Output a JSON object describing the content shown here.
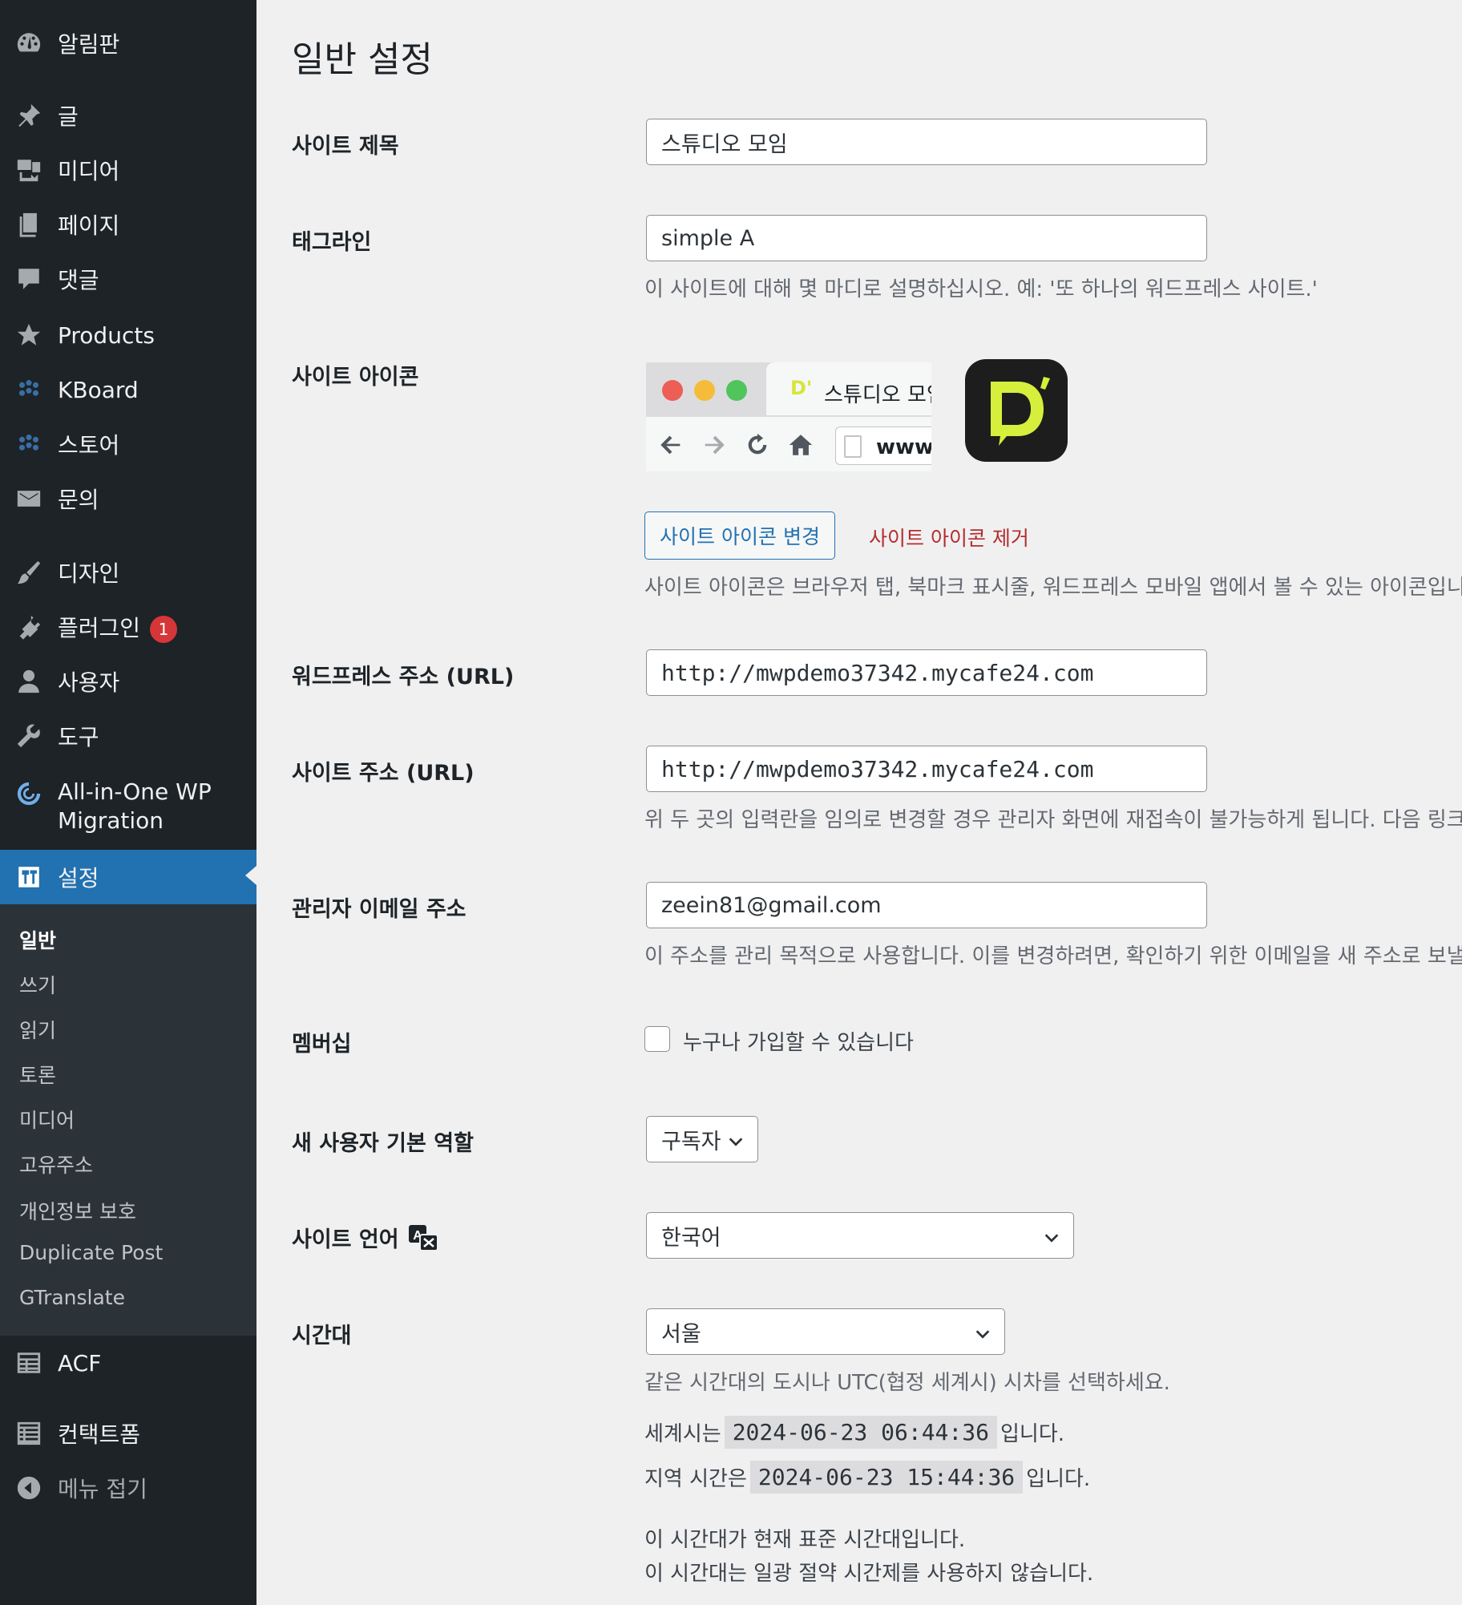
{
  "sidebar": {
    "items": [
      {
        "label": "알림판",
        "icon": "dashboard-icon"
      },
      {
        "label": "글",
        "icon": "pin-icon"
      },
      {
        "label": "미디어",
        "icon": "media-icon"
      },
      {
        "label": "페이지",
        "icon": "page-icon"
      },
      {
        "label": "댓글",
        "icon": "comment-icon"
      },
      {
        "label": "Products",
        "icon": "star-icon"
      },
      {
        "label": "KBoard",
        "icon": "kboard-icon"
      },
      {
        "label": "스토어",
        "icon": "store-icon"
      },
      {
        "label": "문의",
        "icon": "mail-icon"
      },
      {
        "label": "디자인",
        "icon": "brush-icon"
      },
      {
        "label": "플러그인",
        "icon": "plugin-icon",
        "badge": "1"
      },
      {
        "label": "사용자",
        "icon": "user-icon"
      },
      {
        "label": "도구",
        "icon": "wrench-icon"
      },
      {
        "label": "All-in-One WP",
        "label2": "Migration",
        "icon": "migration-icon"
      },
      {
        "label": "설정",
        "icon": "settings-icon",
        "current": true
      },
      {
        "label": "ACF",
        "icon": "acf-icon"
      },
      {
        "label": "컨택트폼",
        "icon": "form-icon"
      },
      {
        "label": "메뉴 접기",
        "icon": "collapse-icon"
      }
    ],
    "submenu": [
      "일반",
      "쓰기",
      "읽기",
      "토론",
      "미디어",
      "고유주소",
      "개인정보 보호",
      "Duplicate Post",
      "GTranslate"
    ]
  },
  "page": {
    "title": "일반 설정"
  },
  "fields": {
    "site_title": {
      "label": "사이트 제목",
      "value": "스튜디오 모임"
    },
    "tagline": {
      "label": "태그라인",
      "value": "simple A",
      "description": "이 사이트에 대해 몇 마디로 설명하십시오. 예: '또 하나의 워드프레스 사이트.'"
    },
    "site_icon": {
      "label": "사이트 아이콘",
      "preview_tab_text": "스튜디오 모임",
      "preview_url_text": "www.",
      "change_button": "사이트 아이콘 변경",
      "remove_button": "사이트 아이콘 제거",
      "description": "사이트 아이콘은 브라우저 탭, 북마크 표시줄, 워드프레스 모바일 앱에서 볼 수 있는 아이콘입니"
    },
    "wp_url": {
      "label": "워드프레스 주소 (URL)",
      "value": "http://mwpdemo37342.mycafe24.com"
    },
    "site_url": {
      "label": "사이트 주소 (URL)",
      "value": "http://mwpdemo37342.mycafe24.com",
      "description": "위 두 곳의 입력란을 임의로 변경할 경우 관리자 화면에 재접속이 불가능하게 됩니다. 다음 링크"
    },
    "admin_email": {
      "label": "관리자 이메일 주소",
      "value": "zeein81@gmail.com",
      "description": "이 주소를 관리 목적으로 사용합니다. 이를 변경하려면, 확인하기 위한 이메일을 새 주소로 보낼"
    },
    "membership": {
      "label": "멤버십",
      "checkbox_label": "누구나 가입할 수 있습니다",
      "checked": false
    },
    "default_role": {
      "label": "새 사용자 기본 역할",
      "value": "구독자"
    },
    "site_language": {
      "label": "사이트 언어",
      "value": "한국어"
    },
    "timezone": {
      "label": "시간대",
      "value": "서울",
      "description": "같은 시간대의 도시나 UTC(협정 세계시) 시차를 선택하세요.",
      "utc_prefix": "세계시는",
      "utc_time": "2024-06-23 06:44:36",
      "utc_suffix": "입니다.",
      "local_prefix": "지역 시간은",
      "local_time": "2024-06-23 15:44:36",
      "local_suffix": "입니다.",
      "std_note": "이 시간대가 현재 표준 시간대입니다.",
      "dst_note": "이 시간대는 일광 절약 시간제를 사용하지 않습니다."
    }
  },
  "colors": {
    "sidebar_bg": "#1d2327",
    "submenu_bg": "#2c3338",
    "accent": "#2271b1",
    "danger": "#b32d2e",
    "badge": "#d63638"
  }
}
